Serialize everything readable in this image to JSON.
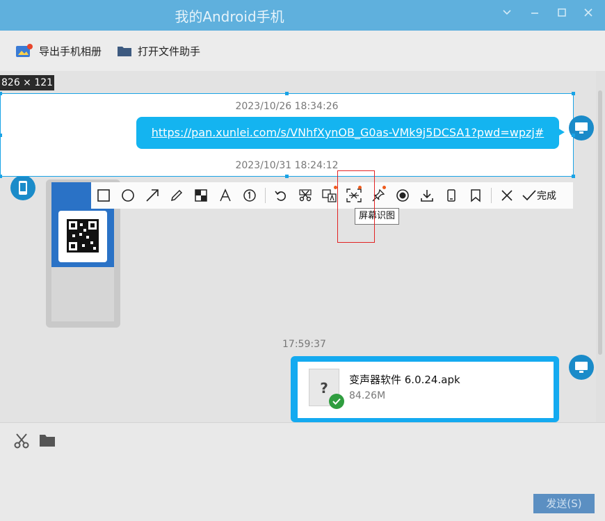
{
  "window": {
    "title": "我的Android手机"
  },
  "toolbar": {
    "export_album": "导出手机相册",
    "open_file_helper": "打开文件助手"
  },
  "selection": {
    "size_label": "826 × 121"
  },
  "messages": {
    "ts1": "2023/10/26 18:34:26",
    "link": "https://pan.xunlei.com/s/VNhfXynOB_G0as-VMk9j5DCSA1?pwd=wpzj#",
    "ts2": "2023/10/31 18:24:12",
    "ts3": "17:59:37",
    "file_name": "变声器软件 6.0.24.apk",
    "file_size": "84.26M",
    "file_icon": "?"
  },
  "snip_toolbar": {
    "done_label": "完成",
    "tooltip": "屏幕识图"
  },
  "footer": {
    "send_label": "发送(S)"
  },
  "colors": {
    "accent": "#14b4f0",
    "titlebar": "#5fb0dd",
    "highlight_box": "#e22222"
  }
}
